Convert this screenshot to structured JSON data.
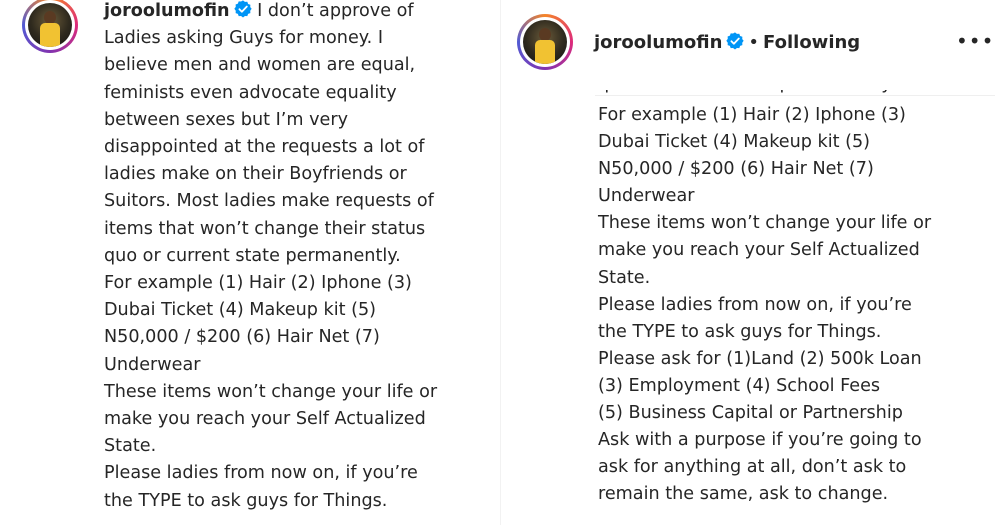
{
  "left_post": {
    "username": "joroolumofin",
    "verified_icon": "verified-badge-icon",
    "caption_lines": [
      "I don’t approve of",
      "Ladies asking Guys for money. I",
      "believe men and women are equal,",
      "feminists even advocate equality",
      "between sexes but I’m very",
      "disappointed at the requests a lot of",
      "ladies make on their Boyfriends or",
      "Suitors. Most ladies make requests of",
      "items that won’t change their status",
      "quo or current state permanently.",
      "For example (1) Hair (2) Iphone (3)",
      "Dubai Ticket (4) Makeup kit (5)",
      "N50,000 / $200 (6) Hair Net (7)",
      "Underwear",
      "These items won’t change your life or",
      "make you reach your Self Actualized",
      "State.",
      "Please ladies from now on, if you’re",
      "the TYPE to ask guys for Things."
    ]
  },
  "right_post": {
    "username": "joroolumofin",
    "verified_icon": "verified-badge-icon",
    "separator": "•",
    "follow_status": "Following",
    "more_icon": "•••",
    "partial_line": "quo or current state permanently.",
    "caption_lines": [
      "For example (1) Hair (2) Iphone (3)",
      "Dubai Ticket (4) Makeup kit (5)",
      "N50,000 / $200 (6) Hair Net (7)",
      "Underwear",
      "These items won’t change your life or",
      "make you reach your Self Actualized",
      "State.",
      "Please ladies from now on, if you’re",
      "the TYPE to ask guys for Things.",
      "Please ask for (1)Land (2) 500k Loan",
      "(3) Employment (4) School Fees",
      "(5) Business Capital or Partnership",
      "Ask with a purpose if you’re going to",
      "ask for anything at all, don’t ask to",
      "remain the same, ask to change."
    ]
  },
  "colors": {
    "text": "#262626",
    "verified": "#0095f6",
    "story_ring": [
      "#f58529",
      "#dd2a7b",
      "#8134af",
      "#515bd4"
    ]
  }
}
